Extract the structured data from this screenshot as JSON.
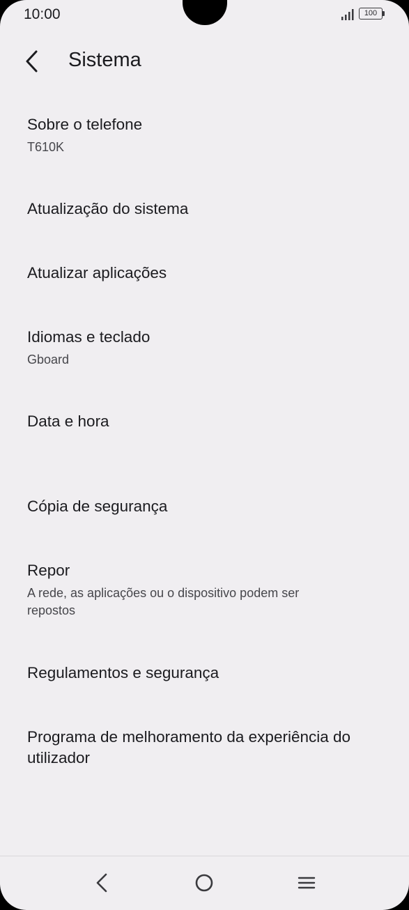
{
  "status_bar": {
    "time": "10:00",
    "battery_level": "100"
  },
  "app_bar": {
    "title": "Sistema"
  },
  "items": [
    {
      "title": "Sobre o telefone",
      "subtitle": "T610K"
    },
    {
      "title": "Atualização do sistema"
    },
    {
      "title": "Atualizar aplicações"
    },
    {
      "title": "Idiomas e teclado",
      "subtitle": "Gboard"
    },
    {
      "title": "Data e hora"
    },
    {
      "title": "Cópia de segurança"
    },
    {
      "title": "Repor",
      "subtitle_line1": "A rede, as aplicações ou o dispositivo podem ser",
      "subtitle_line2": "repostos"
    },
    {
      "title": "Regulamentos e segurança"
    },
    {
      "title_line1": "Programa de melhoramento da experiência do",
      "title_line2": "utilizador"
    }
  ],
  "icons": {
    "back": "chevron-left-icon",
    "nav_back": "nav-back-icon",
    "nav_home": "nav-home-icon",
    "nav_menu": "nav-menu-icon",
    "signal": "signal-icon",
    "battery": "battery-icon"
  }
}
